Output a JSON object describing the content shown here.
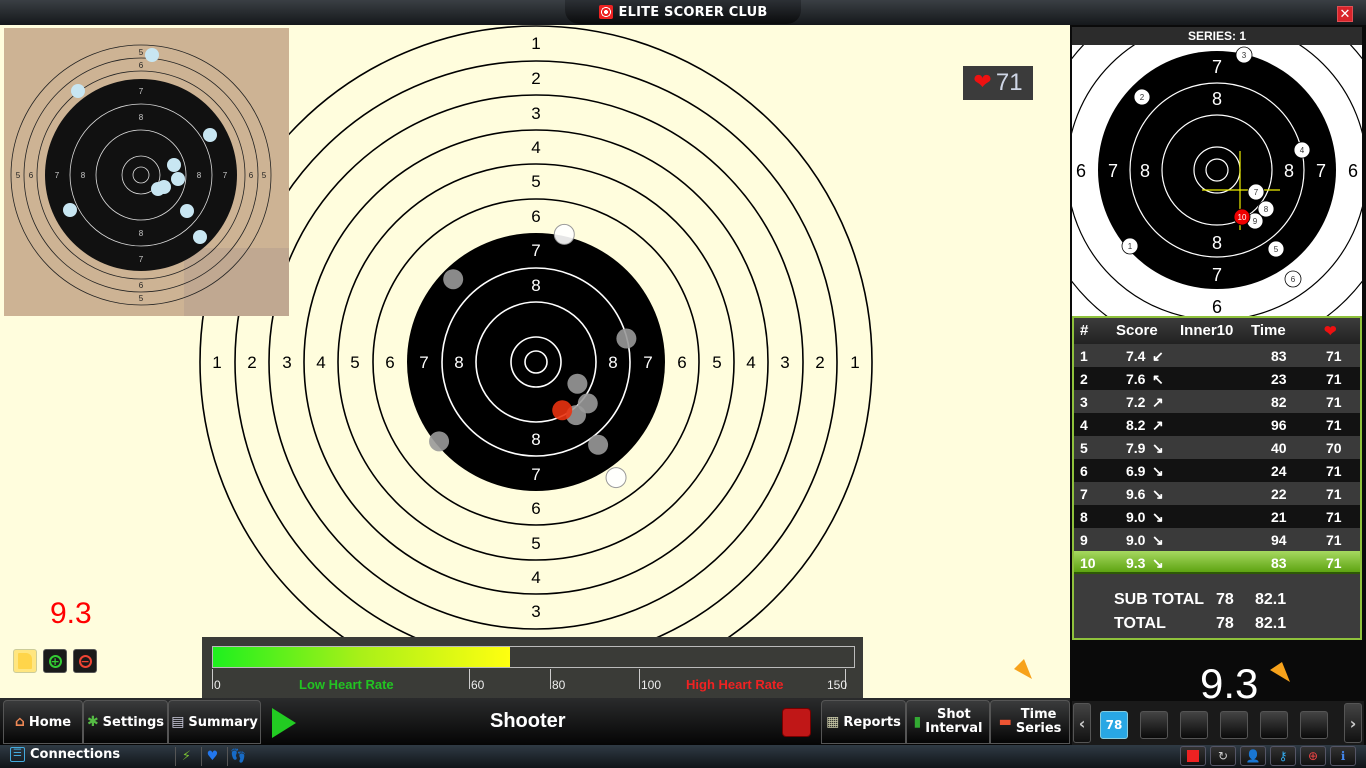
{
  "window": {
    "title": "ELITE SCORER CLUB",
    "close_label": "✕"
  },
  "target": {
    "outer_ring_labels": [
      "1",
      "2",
      "3",
      "4",
      "5",
      "6"
    ],
    "black_ring_labels": [
      "7",
      "8"
    ],
    "shots": [
      {
        "n": 1,
        "dx": -2.81,
        "dy": 2.3,
        "state": "gray"
      },
      {
        "n": 2,
        "dx": -2.4,
        "dy": -2.4,
        "state": "gray"
      },
      {
        "n": 3,
        "dx": 0.82,
        "dy": -3.7,
        "state": "white"
      },
      {
        "n": 4,
        "dx": 2.62,
        "dy": -0.68,
        "state": "gray"
      },
      {
        "n": 5,
        "dx": 1.8,
        "dy": 2.4,
        "state": "gray"
      },
      {
        "n": 6,
        "dx": 2.32,
        "dy": 3.35,
        "state": "white"
      },
      {
        "n": 7,
        "dx": 1.2,
        "dy": 0.63,
        "state": "gray"
      },
      {
        "n": 8,
        "dx": 1.5,
        "dy": 1.2,
        "state": "gray"
      },
      {
        "n": 9,
        "dx": 1.16,
        "dy": 1.54,
        "state": "gray"
      },
      {
        "n": 10,
        "dx": 0.76,
        "dy": 1.4,
        "state": "red"
      }
    ]
  },
  "photo_target": {
    "ring_labels": [
      "5",
      "6",
      "7",
      "8"
    ]
  },
  "heart_rate_badge": {
    "value": "71"
  },
  "last_shot": {
    "score": "9.3"
  },
  "tools": [
    {
      "name": "note",
      "glyph": ""
    },
    {
      "name": "zoom-in",
      "glyph": "+"
    },
    {
      "name": "zoom-out",
      "glyph": "−"
    }
  ],
  "heart_rate_bar": {
    "value": 71,
    "max": 150,
    "ticks": [
      "0",
      "60",
      "80",
      "100",
      "150"
    ],
    "tick_values": [
      0,
      60,
      80,
      100,
      150
    ],
    "low_label": "Low Heart Rate",
    "high_label": "High Heart Rate"
  },
  "nav": {
    "home": "Home",
    "settings": "Settings",
    "summary": "Summary",
    "shooter": "Shooter",
    "reports": "Reports",
    "shot_interval": [
      "Shot",
      "Interval"
    ],
    "time_series": [
      "Time",
      "Series"
    ]
  },
  "status": {
    "connections": "Connections"
  },
  "series": {
    "title": "SERIES: 1"
  },
  "mini_target": {
    "ring_labels_outer": [
      "6",
      "7",
      "8"
    ]
  },
  "table": {
    "headers": {
      "num": "#",
      "score": "Score",
      "inner10": "Inner10",
      "time": "Time"
    },
    "rows": [
      {
        "n": "1",
        "score": "7.4",
        "dir": "↙",
        "inner10": "",
        "time": "83",
        "hr": "71"
      },
      {
        "n": "2",
        "score": "7.6",
        "dir": "↖",
        "inner10": "",
        "time": "23",
        "hr": "71"
      },
      {
        "n": "3",
        "score": "7.2",
        "dir": "↗",
        "inner10": "",
        "time": "82",
        "hr": "71"
      },
      {
        "n": "4",
        "score": "8.2",
        "dir": "↗",
        "inner10": "",
        "time": "96",
        "hr": "71"
      },
      {
        "n": "5",
        "score": "7.9",
        "dir": "↘",
        "inner10": "",
        "time": "40",
        "hr": "70"
      },
      {
        "n": "6",
        "score": "6.9",
        "dir": "↘",
        "inner10": "",
        "time": "24",
        "hr": "71"
      },
      {
        "n": "7",
        "score": "9.6",
        "dir": "↘",
        "inner10": "",
        "time": "22",
        "hr": "71"
      },
      {
        "n": "8",
        "score": "9.0",
        "dir": "↘",
        "inner10": "",
        "time": "21",
        "hr": "71"
      },
      {
        "n": "9",
        "score": "9.0",
        "dir": "↘",
        "inner10": "",
        "time": "94",
        "hr": "71"
      },
      {
        "n": "10",
        "score": "9.3",
        "dir": "↘",
        "inner10": "",
        "time": "83",
        "hr": "71"
      }
    ],
    "selected_row": 10,
    "sub_total": {
      "label": "SUB TOTAL",
      "int": "78",
      "dec": "82.1"
    },
    "total": {
      "label": "TOTAL",
      "int": "78",
      "dec": "82.1"
    }
  },
  "big_score": "9.3",
  "pager": {
    "prev": "‹",
    "next": "›",
    "slots": [
      "78",
      "",
      "",
      "",
      "",
      ""
    ]
  },
  "colors": {
    "accent_green": "#8fc23c",
    "heart_red": "#e11111",
    "score_red": "#ff0000",
    "shot_red": "#e8320f",
    "pager_blue": "#29a7e4"
  }
}
